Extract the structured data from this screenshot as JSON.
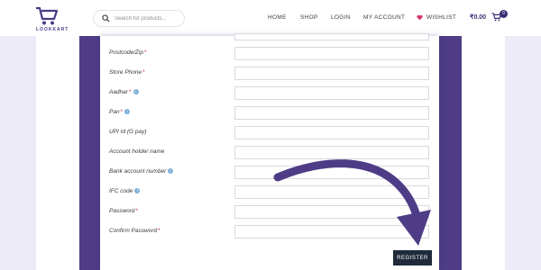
{
  "header": {
    "logo_text": "LOOKKART",
    "search_placeholder": "Search for products...",
    "nav": [
      "HOME",
      "SHOP",
      "LOGIN",
      "MY ACCOUNT",
      "WISHLIST"
    ],
    "cart_amount": "₹0.00",
    "cart_count": "0"
  },
  "form": {
    "fields": [
      {
        "label": "Postcode/Zip",
        "required": "*"
      },
      {
        "label": "Store Phone",
        "required": "*"
      },
      {
        "label": "Aadhar",
        "required": "*"
      },
      {
        "label": "Pan",
        "required": "*"
      },
      {
        "label": "UPI Id (G pay)"
      },
      {
        "label": "Account holder name"
      },
      {
        "label": "Bank account number"
      },
      {
        "label": "IFC code"
      },
      {
        "label": "Password",
        "required": "*"
      },
      {
        "label": "Confirm Password",
        "required": "*"
      }
    ],
    "register_label": "REGISTER"
  },
  "colors": {
    "brand": "#4e3d86",
    "required": "#d6224b",
    "button": "#1f2a3a"
  }
}
